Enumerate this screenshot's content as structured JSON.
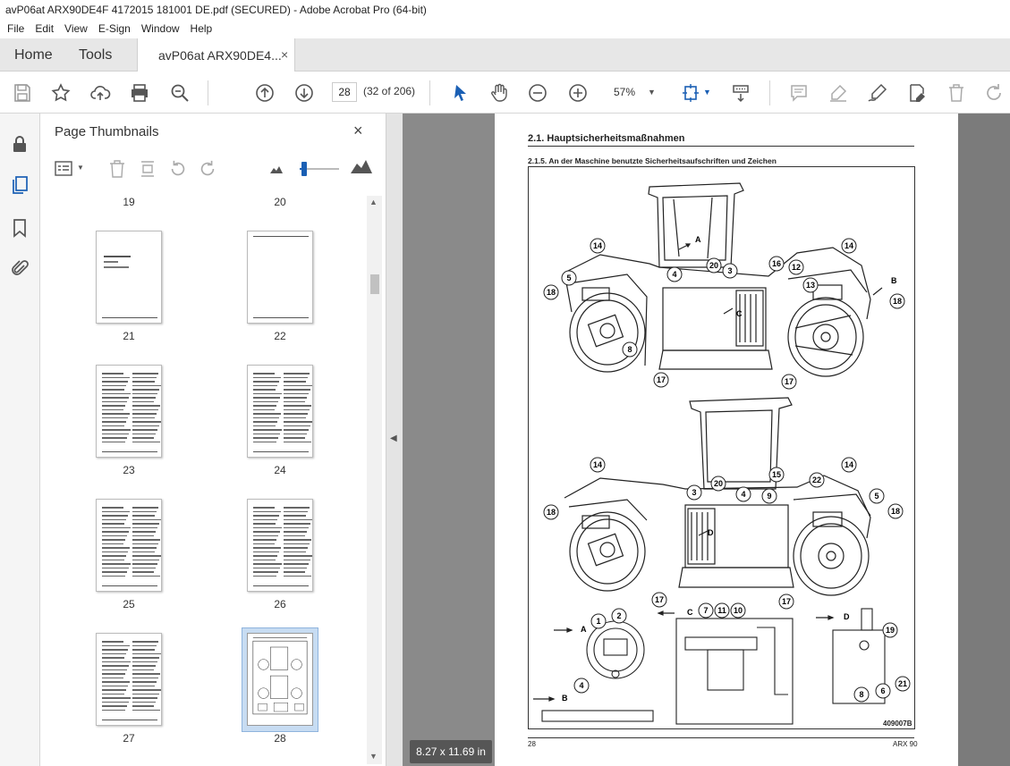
{
  "window": {
    "title": "avP06at ARX90DE4F 4172015 181001 DE.pdf (SECURED) - Adobe Acrobat Pro (64-bit)"
  },
  "menu": [
    "File",
    "Edit",
    "View",
    "E-Sign",
    "Window",
    "Help"
  ],
  "tabs": {
    "home": "Home",
    "tools": "Tools",
    "doc": "avP06at ARX90DE4...",
    "close": "×"
  },
  "toolbar": {
    "page_value": "28",
    "page_count": "(32 of 206)",
    "zoom": "57%"
  },
  "panel": {
    "title": "Page Thumbnails",
    "close": "×",
    "pages_top": [
      "19",
      "20"
    ],
    "rows": [
      [
        "21",
        "22"
      ],
      [
        "23",
        "24"
      ],
      [
        "25",
        "26"
      ],
      [
        "27",
        "28"
      ]
    ]
  },
  "document": {
    "heading1": "2.1.    Hauptsicherheitsmaßnahmen",
    "heading2": "2.1.5.    An der Maschine benutzte Sicherheitsaufschriften und Zeichen",
    "figure_id": "409007B",
    "footer_left": "28",
    "footer_right": "ARX 90",
    "callouts_top": [
      "14",
      "5",
      "18",
      "4",
      "20",
      "3",
      "8",
      "17",
      "16",
      "12",
      "13",
      "14",
      "18",
      "17"
    ],
    "callouts_bottom": [
      "14",
      "18",
      "3",
      "20",
      "4",
      "15",
      "9",
      "22",
      "14",
      "5",
      "18",
      "17",
      "17"
    ],
    "callouts_detail": [
      "1",
      "2",
      "4",
      "7",
      "11",
      "10",
      "19",
      "8",
      "6",
      "21"
    ],
    "view_letters": [
      "A",
      "B",
      "C",
      "D",
      "A",
      "B",
      "C",
      "D"
    ]
  },
  "page_size": "8.27 x 11.69 in"
}
